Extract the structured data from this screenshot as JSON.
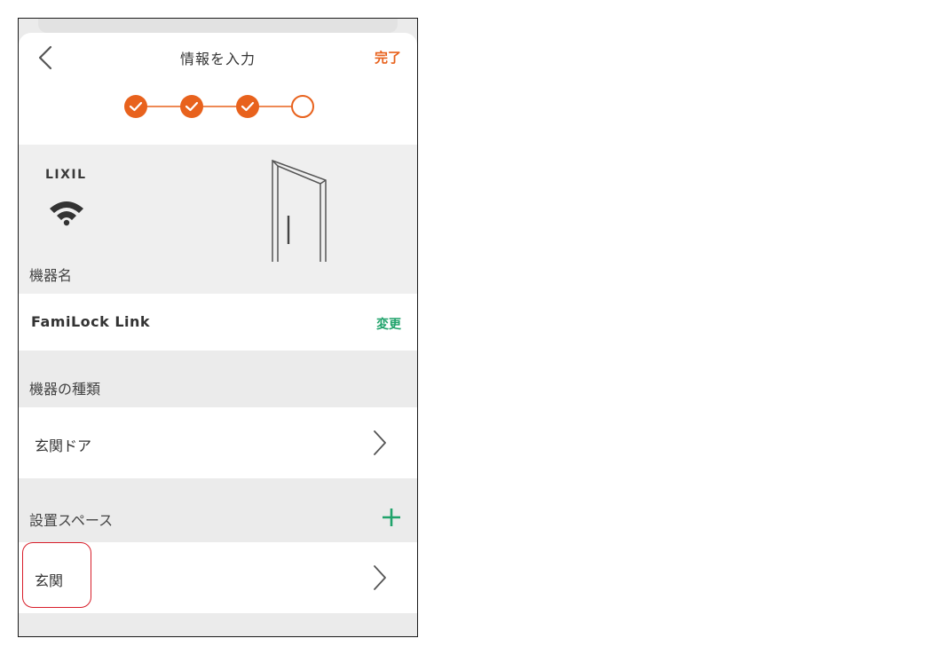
{
  "header": {
    "title": "情報を入力",
    "done_label": "完了"
  },
  "stepper": {
    "total_steps": 4,
    "completed_steps": 3
  },
  "device": {
    "brand": "LIXIL",
    "connection_icon": "wifi-icon",
    "image_icon": "door-icon"
  },
  "device_name": {
    "section_label": "機器名",
    "value": "FamiLock Link",
    "change_label": "変更"
  },
  "device_type": {
    "section_label": "機器の種類",
    "value": "玄関ドア"
  },
  "install_space": {
    "section_label": "設置スペース",
    "value": "玄関"
  },
  "colors": {
    "accent_orange": "#e8621d",
    "accent_green": "#20a36b",
    "highlight_red": "#d81e2a"
  }
}
